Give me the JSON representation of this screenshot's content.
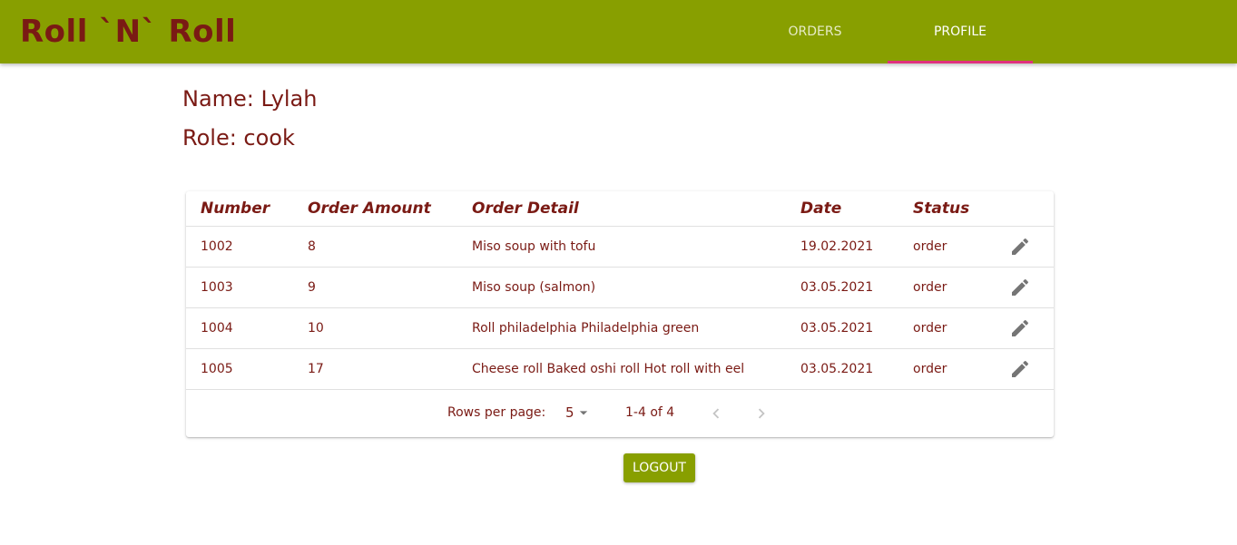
{
  "app": {
    "title": "Roll `N` Roll"
  },
  "nav": {
    "tabs": [
      {
        "label": "ORDERS",
        "active": false
      },
      {
        "label": "PROFILE",
        "active": true
      }
    ],
    "indicator_color": "#e0307c"
  },
  "colors": {
    "brand": "#889f00",
    "text": "#7a1a14"
  },
  "profile": {
    "name_line": "Name: Lylah",
    "role_line": "Role: cook"
  },
  "table": {
    "headers": [
      "Number",
      "Order Amount",
      "Order Detail",
      "Date",
      "Status"
    ],
    "action_icon": "pencil-icon",
    "rows": [
      {
        "number": "1002",
        "amount": "8",
        "detail": "Miso soup with tofu",
        "date": "19.02.2021",
        "status": "order"
      },
      {
        "number": "1003",
        "amount": "9",
        "detail": "Miso soup (salmon)",
        "date": "03.05.2021",
        "status": "order"
      },
      {
        "number": "1004",
        "amount": "10",
        "detail": "Roll philadelphia Philadelphia green",
        "date": "03.05.2021",
        "status": "order"
      },
      {
        "number": "1005",
        "amount": "17",
        "detail": "Cheese roll Baked oshi roll Hot roll with eel",
        "date": "03.05.2021",
        "status": "order"
      }
    ]
  },
  "pagination": {
    "rows_per_page_label": "Rows per page:",
    "rows_per_page_value": "5",
    "range_text": "1-4 of 4"
  },
  "logout": {
    "label": "LOGOUT"
  }
}
